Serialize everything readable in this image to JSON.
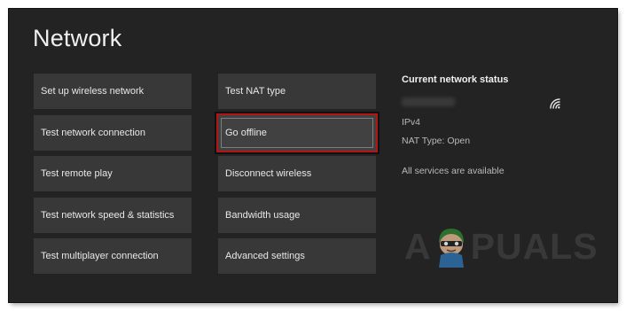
{
  "page": {
    "title": "Network"
  },
  "tiles_left": [
    {
      "label": "Set up wireless network"
    },
    {
      "label": "Test network connection"
    },
    {
      "label": "Test remote play"
    },
    {
      "label": "Test network speed & statistics"
    },
    {
      "label": "Test multiplayer connection"
    }
  ],
  "tiles_right": [
    {
      "label": "Test NAT type"
    },
    {
      "label": "Go offline",
      "selected": true
    },
    {
      "label": "Disconnect wireless"
    },
    {
      "label": "Bandwidth usage"
    },
    {
      "label": "Advanced settings"
    }
  ],
  "status": {
    "title": "Current network status",
    "ip_version": "IPv4",
    "nat_type": "NAT Type: Open",
    "services": "All services are available",
    "connection_icon": "wifi-icon"
  },
  "watermark": {
    "left": "A",
    "right": "PUALS"
  },
  "colors": {
    "background": "#232323",
    "tile": "#383838",
    "selection_highlight": "#b11616"
  }
}
